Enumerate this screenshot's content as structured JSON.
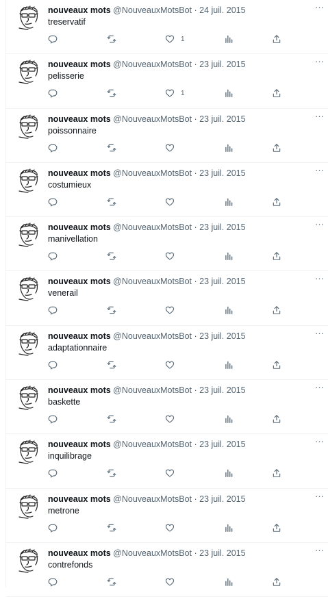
{
  "account": {
    "name": "nouveaux mots",
    "handle": "@NouveauxMotsBot"
  },
  "separator": "·",
  "more_glyph": "···",
  "icons": [
    "avatar-sketch",
    "reply-icon",
    "retweet-icon",
    "like-icon",
    "views-icon",
    "share-icon"
  ],
  "colors": {
    "text": "#0f1419",
    "secondary": "#536471",
    "border": "#eff3f4",
    "background": "#ffffff"
  },
  "tweets": [
    {
      "date": "24 juil. 2015",
      "text": "treservatif",
      "likes": "1"
    },
    {
      "date": "23 juil. 2015",
      "text": "pelisserie",
      "likes": "1"
    },
    {
      "date": "23 juil. 2015",
      "text": "poissonnaire",
      "likes": ""
    },
    {
      "date": "23 juil. 2015",
      "text": "costumieux",
      "likes": ""
    },
    {
      "date": "23 juil. 2015",
      "text": "manivellation",
      "likes": ""
    },
    {
      "date": "23 juil. 2015",
      "text": "venerail",
      "likes": ""
    },
    {
      "date": "23 juil. 2015",
      "text": "adaptationnaire",
      "likes": ""
    },
    {
      "date": "23 juil. 2015",
      "text": "baskette",
      "likes": ""
    },
    {
      "date": "23 juil. 2015",
      "text": "inquilibrage",
      "likes": ""
    },
    {
      "date": "23 juil. 2015",
      "text": "metrone",
      "likes": ""
    },
    {
      "date": "23 juil. 2015",
      "text": "contrefonds",
      "likes": ""
    }
  ]
}
